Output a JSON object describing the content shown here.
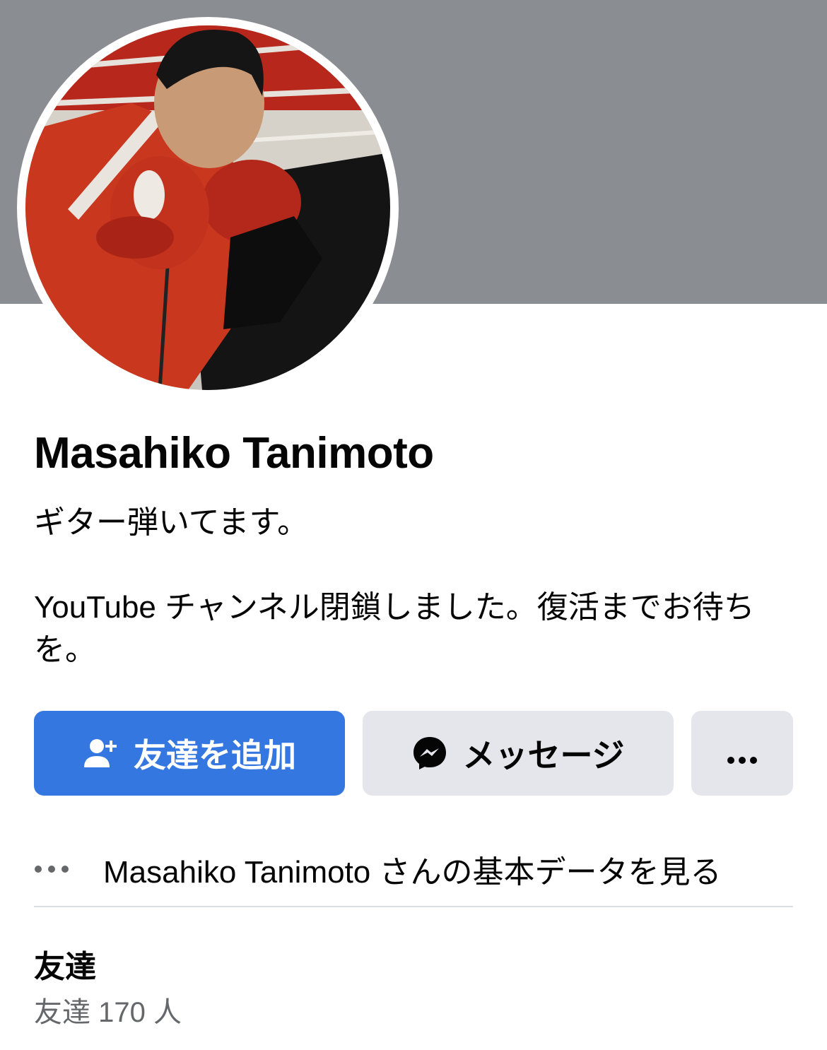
{
  "profile": {
    "name": "Masahiko Tanimoto",
    "bio_line1": "ギター弾いてます。",
    "bio_line2": "YouTube チャンネル閉鎖しました。復活までお待ちを。",
    "avatar_description": "profile-photo-boxer"
  },
  "actions": {
    "add_friend_label": "友達を追加",
    "message_label": "メッセージ",
    "more_label": "•••",
    "add_friend_icon": "person-add-icon",
    "message_icon": "messenger-icon"
  },
  "about": {
    "icon": "more-dots-icon",
    "text": "Masahiko Tanimoto さんの基本データを見る"
  },
  "friends": {
    "title": "友達",
    "count_text": "友達 170 人"
  },
  "colors": {
    "cover": "#8a8d91",
    "primary_button": "#3577e0",
    "secondary_button": "#e4e6eb",
    "muted_text": "#65676b"
  }
}
